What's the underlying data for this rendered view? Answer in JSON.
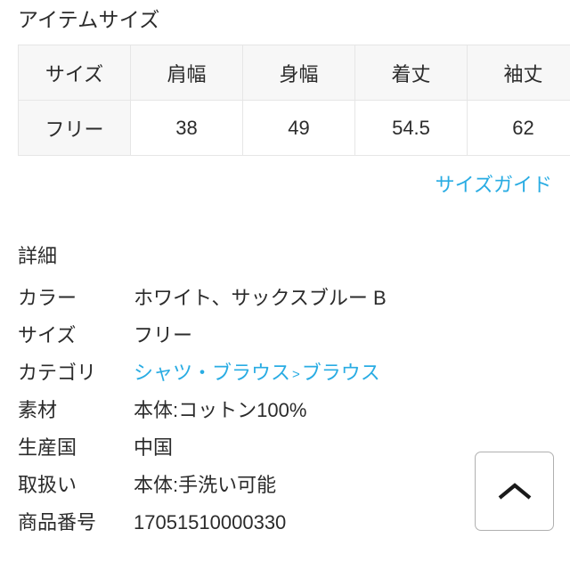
{
  "size_section": {
    "heading": "アイテムサイズ",
    "table": {
      "columns": [
        "サイズ",
        "肩幅",
        "身幅",
        "着丈",
        "袖丈"
      ],
      "rows": [
        [
          "フリー",
          "38",
          "49",
          "54.5",
          "62"
        ]
      ]
    },
    "size_guide_link": "サイズガイド"
  },
  "details_section": {
    "heading": "詳細",
    "rows": [
      {
        "label": "カラー",
        "value": "ホワイト、サックスブルー B",
        "is_link": false
      },
      {
        "label": "サイズ",
        "value": "フリー",
        "is_link": false
      },
      {
        "label": "カテゴリ",
        "value": "シャツ・ブラウス",
        "value2": "ブラウス",
        "separator": ">",
        "is_link": true
      },
      {
        "label": "素材",
        "value": "本体:コットン100%",
        "is_link": false
      },
      {
        "label": "生産国",
        "value": "中国",
        "is_link": false
      },
      {
        "label": "取扱い",
        "value": "本体:手洗い可能",
        "is_link": false
      },
      {
        "label": "商品番号",
        "value": "17051510000330",
        "is_link": false
      }
    ]
  },
  "scroll_top": {
    "icon": "chevron-up-icon",
    "label": "ページ上部へ戻る"
  },
  "colors": {
    "link": "#29ace3",
    "text": "#2b2b2b",
    "table_header_bg": "#f7f7f7",
    "table_border": "#e6e6e6",
    "button_border": "#b0b0b0"
  }
}
